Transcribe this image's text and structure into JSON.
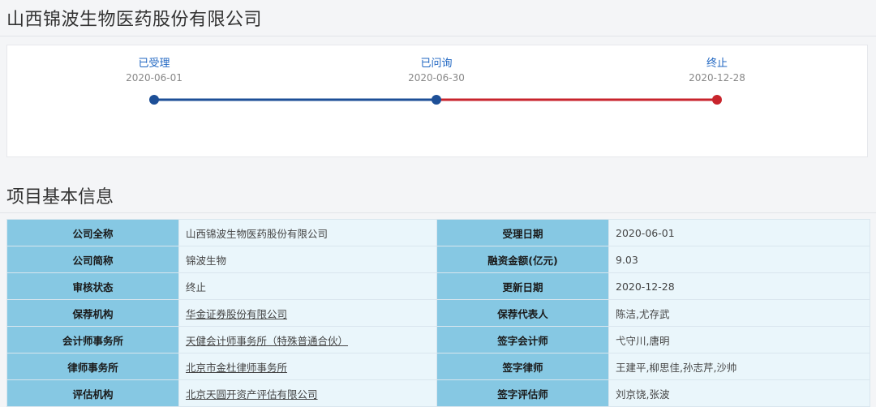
{
  "header": {
    "title": "山西锦波生物医药股份有限公司"
  },
  "timeline": {
    "stages": [
      {
        "label": "已受理",
        "date": "2020-06-01",
        "status": "complete"
      },
      {
        "label": "已问询",
        "date": "2020-06-30",
        "status": "complete"
      },
      {
        "label": "终止",
        "date": "2020-12-28",
        "status": "terminated"
      }
    ],
    "colors": {
      "complete": "#1d4f97",
      "terminated": "#c8242c"
    }
  },
  "section": {
    "title": "项目基本信息"
  },
  "info": {
    "rows": [
      {
        "k1": "公司全称",
        "v1": "山西锦波生物医药股份有限公司",
        "k2": "受理日期",
        "v2": "2020-06-01"
      },
      {
        "k1": "公司简称",
        "v1": "锦波生物",
        "k2": "融资金额(亿元)",
        "v2": "9.03"
      },
      {
        "k1": "审核状态",
        "v1": "终止",
        "k2": "更新日期",
        "v2": "2020-12-28"
      },
      {
        "k1": "保荐机构",
        "v1": "华金证券股份有限公司",
        "k2": "保荐代表人",
        "v2": "陈洁,尤存武"
      },
      {
        "k1": "会计师事务所",
        "v1": "天健会计师事务所（特殊普通合伙）",
        "k2": "签字会计师",
        "v2": "弋守川,唐明"
      },
      {
        "k1": "律师事务所",
        "v1": "北京市金杜律师事务所",
        "k2": "签字律师",
        "v2": "王建平,柳思佳,孙志芹,沙帅"
      },
      {
        "k1": "评估机构",
        "v1": "北京天圆开资产评估有限公司",
        "k2": "签字评估师",
        "v2": "刘京饶,张波"
      }
    ]
  }
}
